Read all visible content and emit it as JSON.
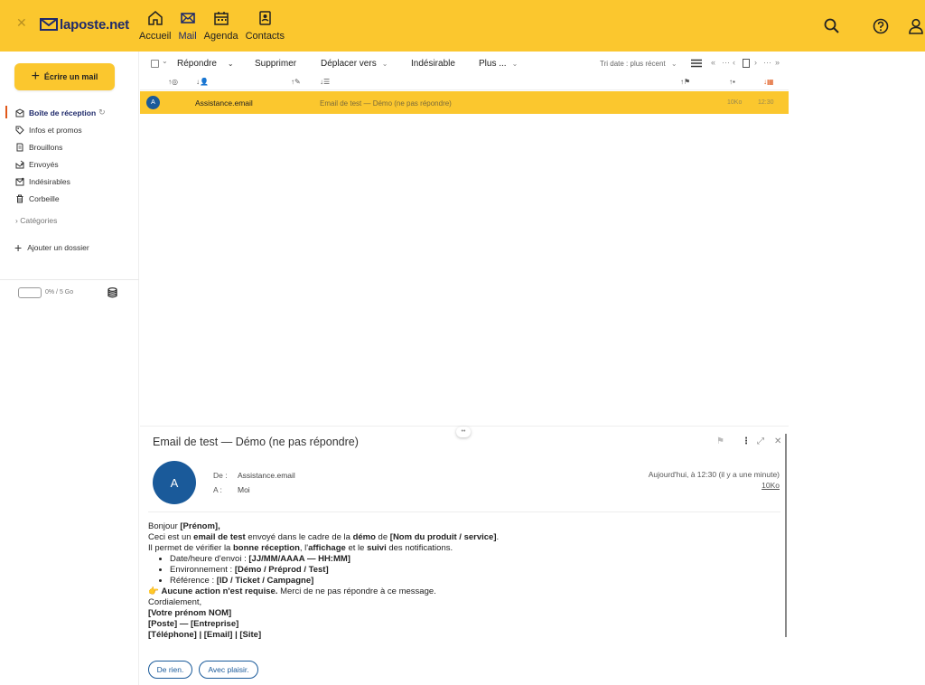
{
  "header": {
    "logo_text": "laposte.net",
    "nav": [
      {
        "label": "Accueil",
        "icon": "home-icon"
      },
      {
        "label": "Mail",
        "icon": "mail-icon"
      },
      {
        "label": "Agenda",
        "icon": "calendar-icon"
      },
      {
        "label": "Contacts",
        "icon": "contacts-icon"
      }
    ],
    "accent_color": "#fbc72e",
    "brand_color": "#1f2a6b"
  },
  "sidebar": {
    "compose_label": "Écrire un mail",
    "folders": [
      {
        "label": "Boîte de réception",
        "icon": "inbox-icon"
      },
      {
        "label": "Infos et promos",
        "icon": "tag-icon"
      },
      {
        "label": "Brouillons",
        "icon": "draft-icon"
      },
      {
        "label": "Envoyés",
        "icon": "sent-icon"
      },
      {
        "label": "Indésirables",
        "icon": "spam-icon"
      },
      {
        "label": "Corbeille",
        "icon": "trash-icon"
      }
    ],
    "categories_label": "Catégories",
    "add_folder_label": "Ajouter un dossier",
    "quota_text": "0% / 5 Go"
  },
  "toolbar": {
    "reply_label": "Répondre",
    "delete_label": "Supprimer",
    "move_label": "Déplacer vers",
    "spam_label": "Indésirable",
    "more_label": "Plus ...",
    "sort_label": "Tri date : plus récent"
  },
  "messages": [
    {
      "avatar": "A",
      "from": "Assistance.email",
      "subject": "Email de test — Démo (ne pas répondre)",
      "size": "10Ko",
      "time": "12:30"
    }
  ],
  "preview": {
    "subject": "Email de test — Démo (ne pas répondre)",
    "avatar": "A",
    "from_label": "De :",
    "from": "Assistance.email",
    "to_label": "A :",
    "to": "Moi",
    "date": "Aujourd'hui, à 12:30 (il y a une minute)",
    "size": "10Ko",
    "body": {
      "greeting_a": "Bonjour ",
      "greeting_b": "[Prénom],",
      "l1": [
        "Ceci est un ",
        "email de test",
        " envoyé dans le cadre de la ",
        "démo",
        " de ",
        "[Nom du produit / service]",
        "."
      ],
      "l2": [
        "Il permet de vérifier la ",
        "bonne réception",
        ", l'",
        "affichage",
        " et le ",
        "suivi",
        " des notifications."
      ],
      "bullets": [
        {
          "label": "Date/heure d'envoi : ",
          "value": "[JJ/MM/AAAA — HH:MM]"
        },
        {
          "label": "Environnement : ",
          "value": "[Démo / Préprod / Test]"
        },
        {
          "label": "Référence : ",
          "value": "[ID / Ticket / Campagne]"
        }
      ],
      "notice_icon": "👉",
      "notice_bold": "Aucune action n'est requise.",
      "notice_rest": " Merci de ne pas répondre à ce message.",
      "closing": "Cordialement,",
      "sig1": "[Votre prénom NOM]",
      "sig2": "[Poste] — [Entreprise]",
      "sig3": "[Téléphone] | [Email] | [Site]"
    },
    "quick_replies": [
      "De rien.",
      "Avec plaisir."
    ]
  }
}
